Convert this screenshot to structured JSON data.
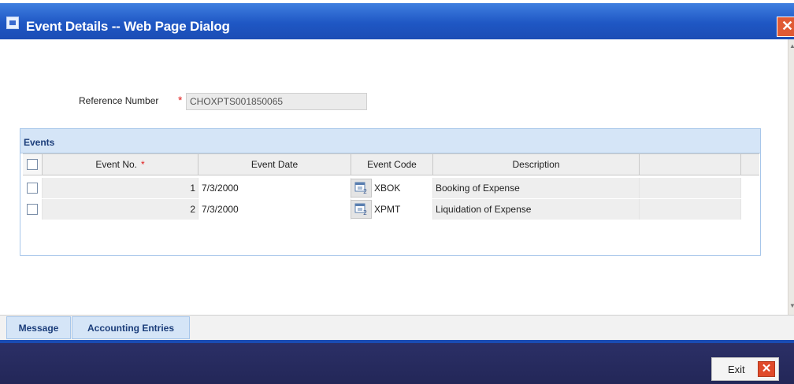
{
  "window": {
    "title": "Event Details -- Web Page Dialog",
    "close_glyph": "✕"
  },
  "reference": {
    "label": "Reference Number",
    "required_mark": "*",
    "value": "CHOXPTS001850065"
  },
  "events": {
    "section_title": "Events",
    "columns": [
      "Event No.",
      "Event Date",
      "Event Code",
      "Description"
    ],
    "required_mark": "*",
    "rows": [
      {
        "no": "1",
        "date": "7/3/2000",
        "code": "XBOK",
        "description": "Booking of Expense"
      },
      {
        "no": "2",
        "date": "7/3/2000",
        "code": "XPMT",
        "description": "Liquidation of Expense"
      }
    ]
  },
  "tabs": [
    "Message",
    "Accounting Entries"
  ],
  "footer": {
    "exit_label": "Exit",
    "exit_glyph": "✕"
  },
  "colors": {
    "title_bar": "#1f57c4",
    "panel_header": "#d5e5f7",
    "footer": "#232758",
    "required": "#e01a1a",
    "exit_icon": "#e04a2a"
  },
  "icons": [
    "window-app-icon",
    "close-icon",
    "calendar-icon",
    "exit-icon"
  ]
}
